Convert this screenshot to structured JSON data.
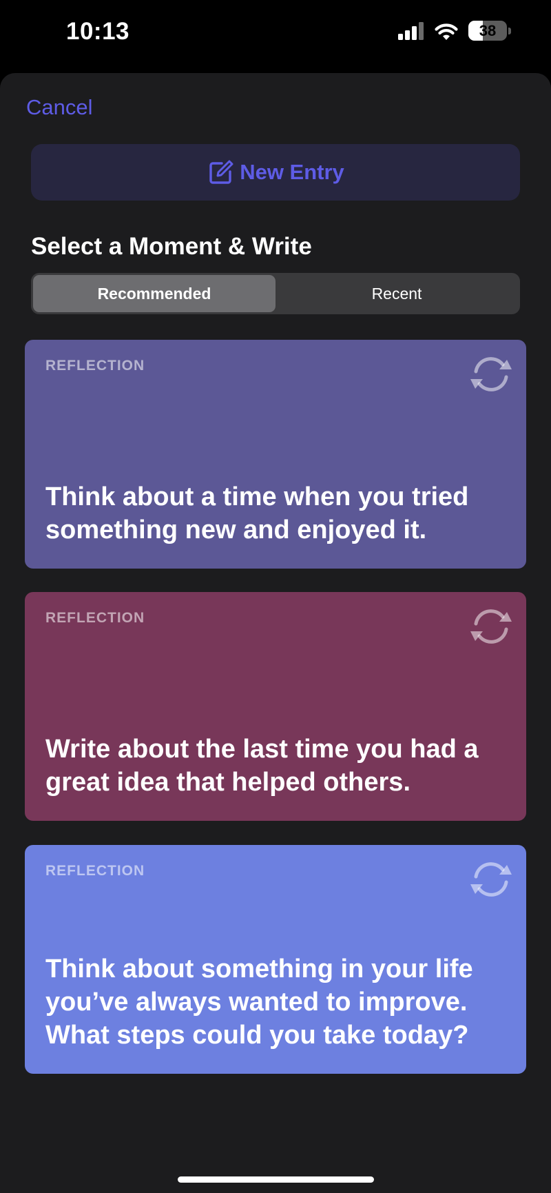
{
  "status": {
    "time": "10:13",
    "battery": "38",
    "battery_level": 0.38
  },
  "header": {
    "cancel_label": "Cancel",
    "new_entry_label": "New Entry"
  },
  "section_title": "Select a Moment & Write",
  "tabs": [
    {
      "label": "Recommended",
      "selected": true
    },
    {
      "label": "Recent",
      "selected": false
    }
  ],
  "cards": [
    {
      "tag": "REFLECTION",
      "text": "Think about a time when you tried something new and enjoyed it.",
      "color": "#5c5896",
      "icon": "refresh-icon"
    },
    {
      "tag": "REFLECTION",
      "text": "Write about the last time you had a great idea that helped others.",
      "color": "#783759",
      "icon": "refresh-icon"
    },
    {
      "tag": "REFLECTION",
      "text": "Think about something in your life you’ve always wanted to improve. What steps could you take today?",
      "color": "#6d80e0",
      "icon": "refresh-icon"
    }
  ],
  "colors": {
    "accent": "#5e5ce6",
    "sheet": "#1c1c1e",
    "background": "#000000"
  }
}
